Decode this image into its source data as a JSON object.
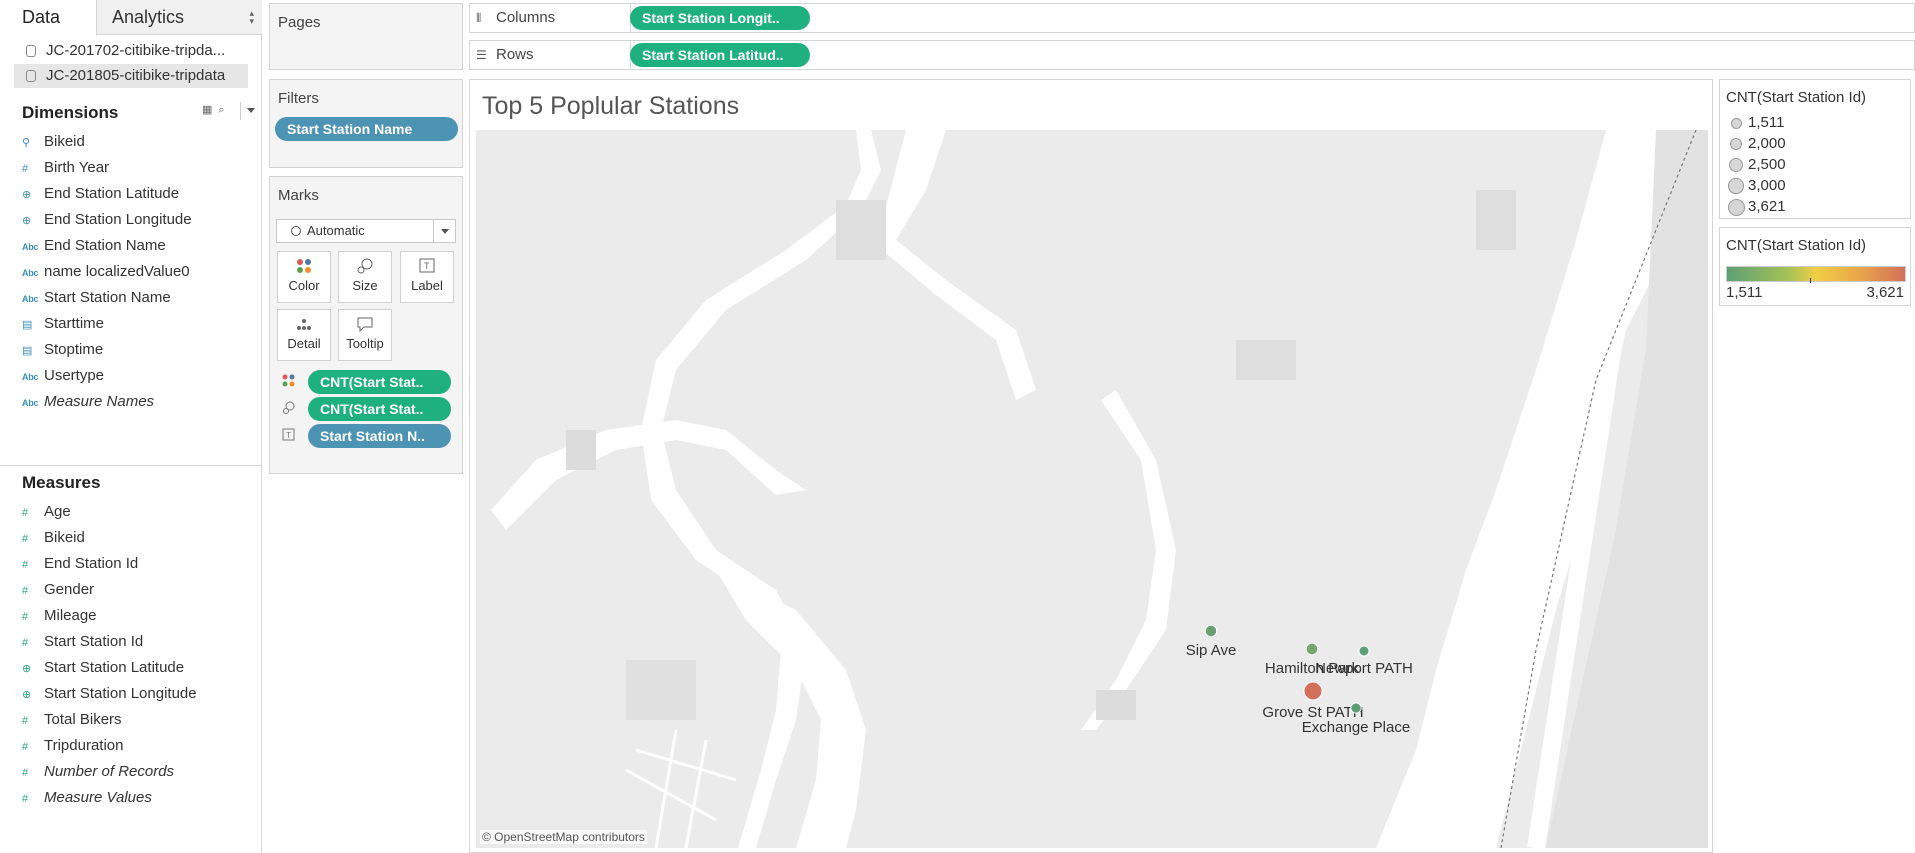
{
  "data_pane": {
    "tabs": [
      "Data",
      "Analytics"
    ],
    "datasources": [
      "JC-201702-citibike-tripda...",
      "JC-201805-citibike-tripdata"
    ],
    "dimensions_title": "Dimensions",
    "dimensions": [
      {
        "label": "Bikeid",
        "icon": "link-icon"
      },
      {
        "label": "Birth Year",
        "icon": "number-icon"
      },
      {
        "label": "End Station Latitude",
        "icon": "globe-icon"
      },
      {
        "label": "End Station Longitude",
        "icon": "globe-icon"
      },
      {
        "label": "End Station Name",
        "icon": "abc-icon"
      },
      {
        "label": "name localizedValue0",
        "icon": "abc-icon"
      },
      {
        "label": "Start Station Name",
        "icon": "abc-icon"
      },
      {
        "label": "Starttime",
        "icon": "calendar-icon"
      },
      {
        "label": "Stoptime",
        "icon": "calendar-icon"
      },
      {
        "label": "Usertype",
        "icon": "abc-icon"
      },
      {
        "label": "Measure Names",
        "icon": "abc-icon"
      }
    ],
    "measures_title": "Measures",
    "measures": [
      {
        "label": "Age",
        "icon": "number-icon"
      },
      {
        "label": "Bikeid",
        "icon": "number-icon"
      },
      {
        "label": "End Station Id",
        "icon": "number-icon"
      },
      {
        "label": "Gender",
        "icon": "number-icon"
      },
      {
        "label": "Mileage",
        "icon": "number-icon"
      },
      {
        "label": "Start Station Id",
        "icon": "number-icon"
      },
      {
        "label": "Start Station Latitude",
        "icon": "globe-icon"
      },
      {
        "label": "Start Station Longitude",
        "icon": "globe-icon"
      },
      {
        "label": "Total Bikers",
        "icon": "number-icon"
      },
      {
        "label": "Tripduration",
        "icon": "number-icon"
      },
      {
        "label": "Number of Records",
        "icon": "number-icon"
      },
      {
        "label": "Measure Values",
        "icon": "number-icon"
      }
    ]
  },
  "cards": {
    "pages_title": "Pages",
    "filters_title": "Filters",
    "filter_pill": "Start Station Name",
    "marks_title": "Marks",
    "mark_type": "Automatic",
    "buttons": {
      "color": "Color",
      "size": "Size",
      "label": "Label",
      "detail": "Detail",
      "tooltip": "Tooltip"
    },
    "encodings": [
      "CNT(Start Stat..",
      "CNT(Start Stat..",
      "Start Station N.."
    ]
  },
  "shelves": {
    "columns_label": "Columns",
    "columns_pill": "Start Station Longit..",
    "rows_label": "Rows",
    "rows_pill": "Start Station Latitud.."
  },
  "worksheet": {
    "title": "Top 5 Poplular Stations",
    "attribution": "© OpenStreetMap contributors",
    "stations": [
      {
        "name": "Sip Ave",
        "count": 1900,
        "color": "#6a9f72"
      },
      {
        "name": "Hamilton Park",
        "count": 1950,
        "color": "#72a86a"
      },
      {
        "name": "Newport PATH",
        "count": 1511,
        "color": "#5d9f74"
      },
      {
        "name": "Grove St PATH",
        "count": 3621,
        "color": "#d3705c"
      },
      {
        "name": "Exchange Place",
        "count": 1600,
        "color": "#5f9e72"
      }
    ]
  },
  "legends": {
    "size_title": "CNT(Start Station Id)",
    "size_values": [
      "1,511",
      "2,000",
      "2,500",
      "3,000",
      "3,621"
    ],
    "color_title": "CNT(Start Station Id)",
    "color_min": "1,511",
    "color_max": "3,621",
    "color_ramp": [
      "#5d9f74",
      "#f1cf45",
      "#d3705c"
    ]
  }
}
